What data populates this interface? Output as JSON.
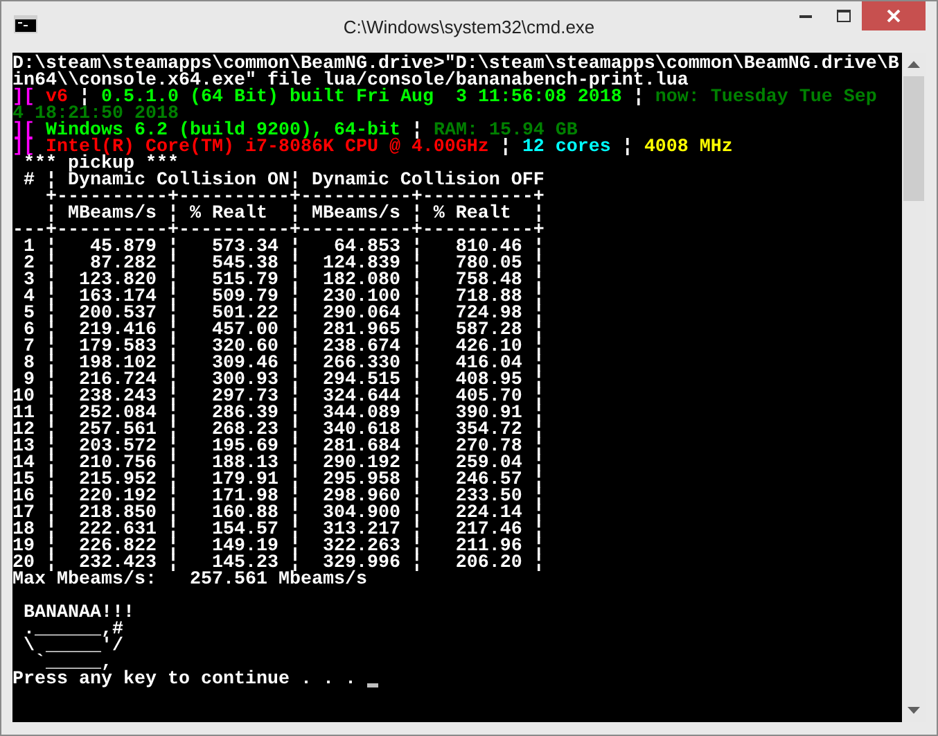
{
  "window": {
    "title": "C:\\Windows\\system32\\cmd.exe"
  },
  "lines": [
    {
      "kind": "text",
      "text": "D:\\steam\\steamapps\\common\\BeamNG.drive>\"D:\\steam\\steamapps\\common\\BeamNG.drive\\B"
    },
    {
      "kind": "text",
      "text": "in64\\\\console.x64.exe\" file lua/console/bananabench-print.lua"
    },
    {
      "kind": "segments",
      "segments": [
        {
          "text": "][",
          "color": "#ff00ff"
        },
        {
          "text": " v6",
          "color": "#ff0000"
        },
        {
          "text": " ¦ ",
          "color": "#ffffff"
        },
        {
          "text": "0.5.1.0 (64 Bit) built Fri Aug  3 11:56:08 2018",
          "color": "#00ff00"
        },
        {
          "text": " ¦ ",
          "color": "#ffffff"
        },
        {
          "text": "now: Tuesday Tue Sep",
          "color": "#008000"
        }
      ]
    },
    {
      "kind": "segments",
      "segments": [
        {
          "text": "4 18:21:50 2018",
          "color": "#008000"
        }
      ]
    },
    {
      "kind": "segments",
      "segments": [
        {
          "text": "][",
          "color": "#ff00ff"
        },
        {
          "text": " Windows 6.2 (build 9200), 64-bit",
          "color": "#00ff00"
        },
        {
          "text": " ¦ ",
          "color": "#ffffff"
        },
        {
          "text": "RAM: 15.94 GB",
          "color": "#008000"
        }
      ]
    },
    {
      "kind": "segments",
      "segments": [
        {
          "text": "][",
          "color": "#ff00ff"
        },
        {
          "text": " Intel(R) Core(TM) i7-8086K CPU @ 4.00GHz",
          "color": "#ff0000"
        },
        {
          "text": " ¦ ",
          "color": "#ffffff"
        },
        {
          "text": "12 cores",
          "color": "#00ffff"
        },
        {
          "text": " ¦ ",
          "color": "#ffffff"
        },
        {
          "text": "4008 MHz",
          "color": "#ffff00"
        }
      ]
    },
    {
      "kind": "text",
      "text": " *** pickup ***"
    },
    {
      "kind": "text",
      "text": " # ¦ Dynamic Collision ON¦ Dynamic Collision OFF"
    },
    {
      "kind": "text",
      "text": "   +----------+----------+----------+----------+"
    },
    {
      "kind": "text",
      "text": "   ¦ MBeams/s ¦ % Realt  ¦ MBeams/s ¦ % Realt  ¦"
    },
    {
      "kind": "text",
      "text": "---+----------+----------+----------+----------+"
    },
    {
      "kind": "text",
      "text": " 1 ¦   45.879 ¦   573.34 ¦   64.853 ¦   810.46 ¦"
    },
    {
      "kind": "text",
      "text": " 2 ¦   87.282 ¦   545.38 ¦  124.839 ¦   780.05 ¦"
    },
    {
      "kind": "text",
      "text": " 3 ¦  123.820 ¦   515.79 ¦  182.080 ¦   758.48 ¦"
    },
    {
      "kind": "text",
      "text": " 4 ¦  163.174 ¦   509.79 ¦  230.100 ¦   718.88 ¦"
    },
    {
      "kind": "text",
      "text": " 5 ¦  200.537 ¦   501.22 ¦  290.064 ¦   724.98 ¦"
    },
    {
      "kind": "text",
      "text": " 6 ¦  219.416 ¦   457.00 ¦  281.965 ¦   587.28 ¦"
    },
    {
      "kind": "text",
      "text": " 7 ¦  179.583 ¦   320.60 ¦  238.674 ¦   426.10 ¦"
    },
    {
      "kind": "text",
      "text": " 8 ¦  198.102 ¦   309.46 ¦  266.330 ¦   416.04 ¦"
    },
    {
      "kind": "text",
      "text": " 9 ¦  216.724 ¦   300.93 ¦  294.515 ¦   408.95 ¦"
    },
    {
      "kind": "text",
      "text": "10 ¦  238.243 ¦   297.73 ¦  324.644 ¦   405.70 ¦"
    },
    {
      "kind": "text",
      "text": "11 ¦  252.084 ¦   286.39 ¦  344.089 ¦   390.91 ¦"
    },
    {
      "kind": "text",
      "text": "12 ¦  257.561 ¦   268.23 ¦  340.618 ¦   354.72 ¦"
    },
    {
      "kind": "text",
      "text": "13 ¦  203.572 ¦   195.69 ¦  281.684 ¦   270.78 ¦"
    },
    {
      "kind": "text",
      "text": "14 ¦  210.756 ¦   188.13 ¦  290.192 ¦   259.04 ¦"
    },
    {
      "kind": "text",
      "text": "15 ¦  215.952 ¦   179.91 ¦  295.958 ¦   246.57 ¦"
    },
    {
      "kind": "text",
      "text": "16 ¦  220.192 ¦   171.98 ¦  298.960 ¦   233.50 ¦"
    },
    {
      "kind": "text",
      "text": "17 ¦  218.850 ¦   160.88 ¦  304.900 ¦   224.14 ¦"
    },
    {
      "kind": "text",
      "text": "18 ¦  222.631 ¦   154.57 ¦  313.217 ¦   217.46 ¦"
    },
    {
      "kind": "text",
      "text": "19 ¦  226.822 ¦   149.19 ¦  322.263 ¦   211.96 ¦"
    },
    {
      "kind": "text",
      "text": "20 ¦  232.423 ¦   145.23 ¦  329.996 ¦   206.20 ¦"
    },
    {
      "kind": "text",
      "text": "Max Mbeams/s:   257.561 Mbeams/s"
    },
    {
      "kind": "blank"
    },
    {
      "kind": "text",
      "text": " BANANAA!!!"
    },
    {
      "kind": "text",
      "text": " .______,#"
    },
    {
      "kind": "text",
      "text": " \\ _____'/"
    },
    {
      "kind": "text",
      "text": "  `_____,"
    },
    {
      "kind": "text",
      "text": "Press any key to continue . . . "
    }
  ]
}
